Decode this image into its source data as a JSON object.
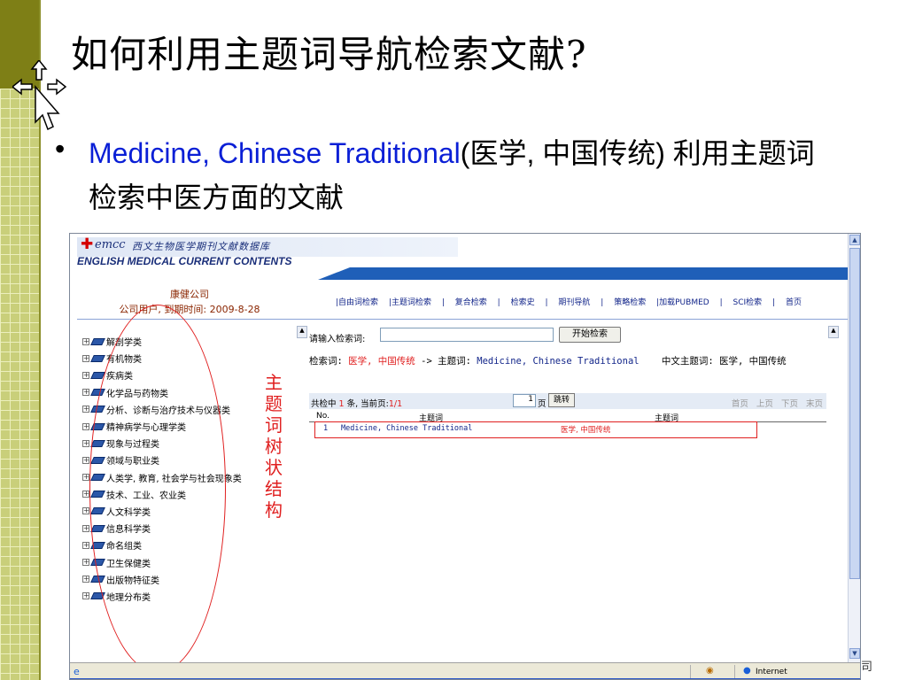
{
  "slide": {
    "title": "如何利用主题词导航检索文献?",
    "bullet_marker": "•",
    "bullet_en": "Medicine, Chinese Traditional",
    "bullet_cn": "(医学, 中国传统) 利用主题词检索中医方面的文献",
    "annotation_vertical": "主题词树状结构",
    "corner_fragment": "司"
  },
  "browser": {
    "logo_mark": "emcc",
    "logo_cn": "西文生物医学期刊文献数据库",
    "banner_en": "ENGLISH MEDICAL CURRENT CONTENTS",
    "user_org": "康健公司",
    "user_info": "公司用户, 到期时间: 2009-8-28",
    "nav": [
      "|自由词检索",
      "|主题词检索",
      "|",
      "复合检索",
      "|",
      "检索史",
      "|",
      "期刊导航",
      "|",
      "策略检索",
      "|加载PUBMED",
      "|",
      "SCI检索",
      "|",
      "首页"
    ],
    "tree": [
      "解剖学类",
      "有机物类",
      "疾病类",
      "化学品与药物类",
      "分析、诊断与治疗技术与仪器类",
      "精神病学与心理学类",
      "现象与过程类",
      "领域与职业类",
      "人类学, 教育, 社会学与社会现象类",
      "技术、工业、农业类",
      "人文科学类",
      "信息科学类",
      "命名组类",
      "卫生保健类",
      "出版物特征类",
      "地理分布类"
    ],
    "search_label": "请输入检索词:",
    "search_value": "",
    "search_button": "开始检索",
    "query_prefix": "检索词:",
    "query_terms": "医学, 中国传统",
    "query_arrow": "-> 主题词:",
    "query_heading": "Medicine, Chinese Traditional",
    "query_cn_label": "中文主题词: 医学, 中国传统",
    "result_count_pre": "共检中",
    "result_count": "1",
    "result_count_mid": "条, 当前页:",
    "result_page": "1/1",
    "page_input": "1",
    "page_unit": "页",
    "jump_button": "跳转",
    "pager": [
      "首页",
      "上页",
      "下页",
      "末页"
    ],
    "table_headers": [
      "No.",
      "主题词",
      "主题词"
    ],
    "rows": [
      {
        "no": "1",
        "en": "Medicine, Chinese Traditional",
        "cn": "医学, 中国传统"
      }
    ],
    "status_zone": "Internet"
  },
  "colors": {
    "accent_blue": "#0a1fd6",
    "annotation_red": "#e02020",
    "stripe": "#c9cf7a"
  }
}
